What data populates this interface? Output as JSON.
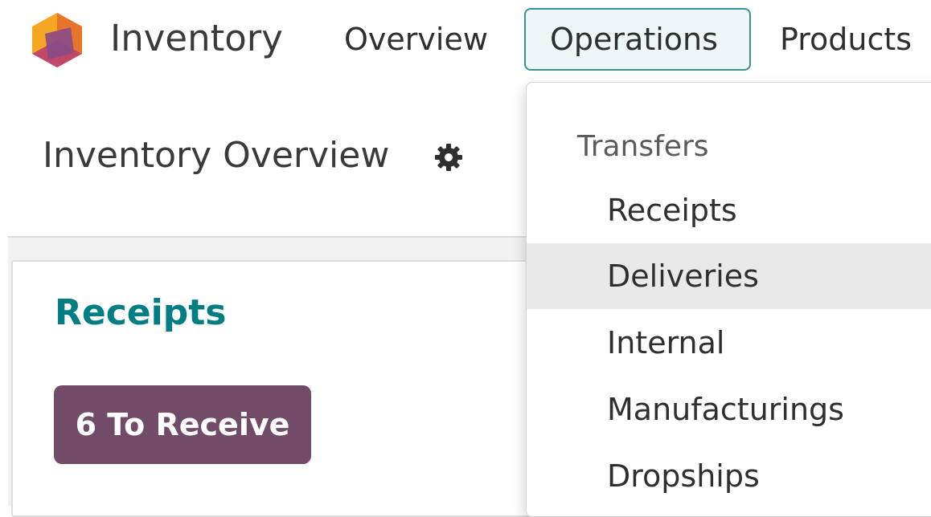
{
  "navbar": {
    "app_name": "Inventory",
    "menus": [
      {
        "label": "Overview"
      },
      {
        "label": "Operations",
        "state": "open"
      },
      {
        "label": "Products"
      }
    ]
  },
  "control_panel": {
    "title": "Inventory Overview",
    "settings_icon": "gear-icon"
  },
  "dropdown": {
    "section_label": "Transfers",
    "items": [
      {
        "label": "Receipts"
      },
      {
        "label": "Deliveries",
        "highlighted": true
      },
      {
        "label": "Internal"
      },
      {
        "label": "Manufacturings"
      },
      {
        "label": "Dropships"
      }
    ]
  },
  "card": {
    "title": "Receipts",
    "button_label": "6 To Receive"
  },
  "colors": {
    "accent": "#017e84",
    "primary": "#714b67",
    "active_menu_bg": "#eef6f7",
    "active_menu_border": "#3f8f96",
    "hover_item_bg": "#e9e9e9"
  }
}
